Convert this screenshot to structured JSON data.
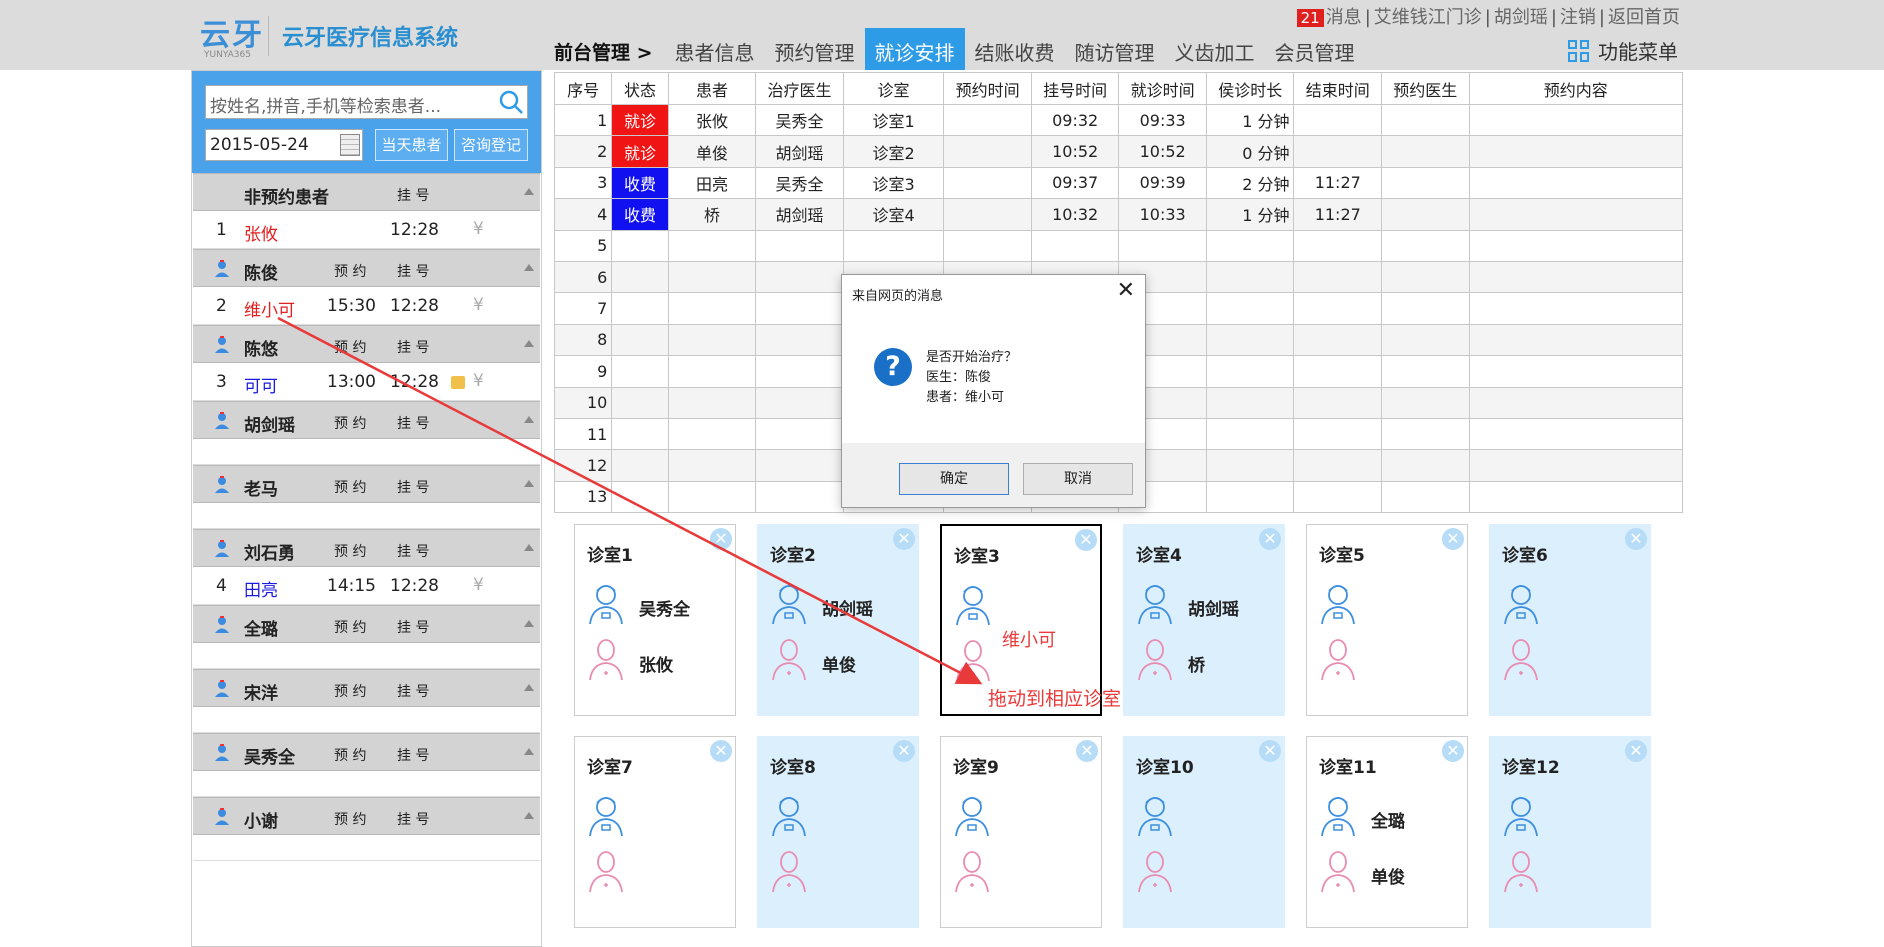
{
  "app": {
    "logo_glyph": "云牙",
    "logo_sub": "YUNYA365",
    "title": "云牙医疗信息系统"
  },
  "toplinks": {
    "badge": "21",
    "messages": "消息",
    "clinic": "艾维钱江门诊",
    "user": "胡剑瑶",
    "logout": "注销",
    "home": "返回首页"
  },
  "nav": {
    "crumb": "前台管理 >",
    "tabs": [
      "患者信息",
      "预约管理",
      "就诊安排",
      "结账收费",
      "随访管理",
      "义齿加工",
      "会员管理"
    ],
    "active_index": 2,
    "func_menu": "功能菜单"
  },
  "sidebar": {
    "search_placeholder": "按姓名,拼音,手机等检索患者...",
    "date": "2015-05-24",
    "btn_today": "当天患者",
    "btn_consult": "咨询登记",
    "groups": [
      {
        "name": "非预约患者",
        "appt": "",
        "reg": "挂 号",
        "has_icon": false,
        "rows": [
          {
            "idx": "1",
            "name": "张攸",
            "appt": "",
            "reg": "12:28",
            "color": "red"
          }
        ]
      },
      {
        "name": "陈俊",
        "appt": "预 约",
        "reg": "挂 号",
        "has_icon": true,
        "rows": [
          {
            "idx": "2",
            "name": "维小可",
            "appt": "15:30",
            "reg": "12:28",
            "color": "red"
          }
        ]
      },
      {
        "name": "陈悠",
        "appt": "预 约",
        "reg": "挂 号",
        "has_icon": true,
        "rows": [
          {
            "idx": "3",
            "name": "可可",
            "appt": "13:00",
            "reg": "12:28",
            "color": "blue",
            "note": true
          }
        ]
      },
      {
        "name": "胡剑瑶",
        "appt": "预 约",
        "reg": "挂 号",
        "has_icon": true,
        "rows": []
      },
      {
        "name": "老马",
        "appt": "预 约",
        "reg": "挂 号",
        "has_icon": true,
        "rows": []
      },
      {
        "name": "刘石勇",
        "appt": "预 约",
        "reg": "挂 号",
        "has_icon": true,
        "rows": [
          {
            "idx": "4",
            "name": "田亮",
            "appt": "14:15",
            "reg": "12:28",
            "color": "blue"
          }
        ]
      },
      {
        "name": "全璐",
        "appt": "预 约",
        "reg": "挂 号",
        "has_icon": true,
        "rows": []
      },
      {
        "name": "宋洋",
        "appt": "预 约",
        "reg": "挂 号",
        "has_icon": true,
        "rows": []
      },
      {
        "name": "吴秀全",
        "appt": "预 约",
        "reg": "挂 号",
        "has_icon": true,
        "rows": []
      },
      {
        "name": "小谢",
        "appt": "预 约",
        "reg": "挂 号",
        "has_icon": true,
        "rows": []
      }
    ],
    "yen": "¥"
  },
  "schedule": {
    "headers": [
      "序号",
      "状态",
      "患者",
      "治疗医生",
      "诊室",
      "预约时间",
      "挂号时间",
      "就诊时间",
      "侯诊时长",
      "结束时间",
      "预约医生",
      "预约内容"
    ],
    "rows": [
      {
        "idx": "1",
        "status": "就诊",
        "status_color": "red",
        "patient": "张攸",
        "doctor": "吴秀全",
        "room": "诊室1",
        "appt": "",
        "reg": "09:32",
        "visit": "09:33",
        "wait": "1 分钟",
        "end": "",
        "appt_doc": "",
        "content": ""
      },
      {
        "idx": "2",
        "status": "就诊",
        "status_color": "red",
        "patient": "单俊",
        "doctor": "胡剑瑶",
        "room": "诊室2",
        "appt": "",
        "reg": "10:52",
        "visit": "10:52",
        "wait": "0 分钟",
        "end": "",
        "appt_doc": "",
        "content": ""
      },
      {
        "idx": "3",
        "status": "收费",
        "status_color": "blue",
        "patient": "田亮",
        "doctor": "吴秀全",
        "room": "诊室3",
        "appt": "",
        "reg": "09:37",
        "visit": "09:39",
        "wait": "2 分钟",
        "end": "11:27",
        "appt_doc": "",
        "content": ""
      },
      {
        "idx": "4",
        "status": "收费",
        "status_color": "blue",
        "patient": "桥",
        "doctor": "胡剑瑶",
        "room": "诊室4",
        "appt": "",
        "reg": "10:32",
        "visit": "10:33",
        "wait": "1 分钟",
        "end": "11:27",
        "appt_doc": "",
        "content": ""
      },
      {
        "idx": "5"
      },
      {
        "idx": "6"
      },
      {
        "idx": "7"
      },
      {
        "idx": "8"
      },
      {
        "idx": "9"
      },
      {
        "idx": "10"
      },
      {
        "idx": "11"
      },
      {
        "idx": "12"
      },
      {
        "idx": "13"
      }
    ]
  },
  "rooms": [
    {
      "name": "诊室1",
      "doctor": "吴秀全",
      "patient": "张攸",
      "blue": false
    },
    {
      "name": "诊室2",
      "doctor": "胡剑瑶",
      "patient": "单俊",
      "blue": true
    },
    {
      "name": "诊室3",
      "doctor": "",
      "patient": "",
      "blue": false,
      "selected": true,
      "drag_name": "维小可"
    },
    {
      "name": "诊室4",
      "doctor": "胡剑瑶",
      "patient": "桥",
      "blue": true
    },
    {
      "name": "诊室5",
      "doctor": "",
      "patient": "",
      "blue": false
    },
    {
      "name": "诊室6",
      "doctor": "",
      "patient": "",
      "blue": true
    },
    {
      "name": "诊室7",
      "doctor": "",
      "patient": "",
      "blue": false
    },
    {
      "name": "诊室8",
      "doctor": "",
      "patient": "",
      "blue": true
    },
    {
      "name": "诊室9",
      "doctor": "",
      "patient": "",
      "blue": false
    },
    {
      "name": "诊室10",
      "doctor": "",
      "patient": "",
      "blue": true
    },
    {
      "name": "诊室11",
      "doctor": "全璐",
      "patient": "单俊",
      "blue": false
    },
    {
      "name": "诊室12",
      "doctor": "",
      "patient": "",
      "blue": true
    }
  ],
  "dialog": {
    "title": "来自网页的消息",
    "line1": "是否开始治疗？",
    "line2": "医生：陈俊",
    "line3": "患者：维小可",
    "ok": "确定",
    "cancel": "取消"
  },
  "annotation": {
    "text": "拖动到相应诊室"
  },
  "colors": {
    "accent": "#2e9be6",
    "status_red": "#f01414",
    "status_blue": "#1010f0",
    "annotation_red": "#e83a3a"
  }
}
